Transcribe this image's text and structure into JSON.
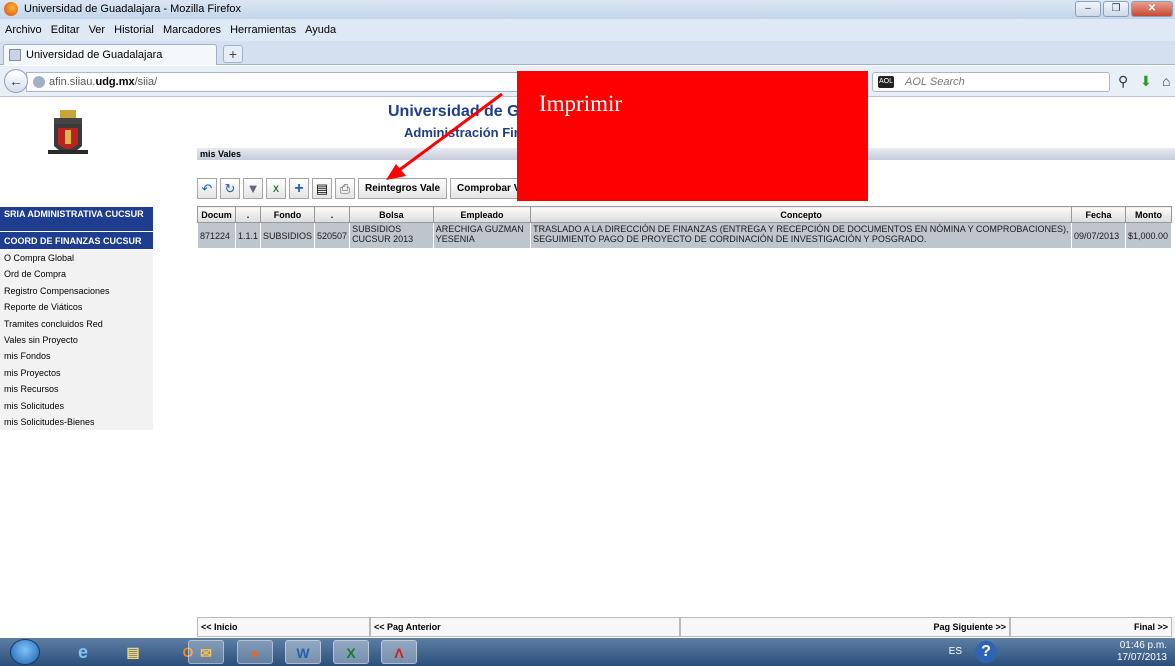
{
  "window": {
    "title": "Universidad de Guadalajara - Mozilla Firefox"
  },
  "menu": [
    "Archivo",
    "Editar",
    "Ver",
    "Historial",
    "Marcadores",
    "Herramientas",
    "Ayuda"
  ],
  "tab": {
    "label": "Universidad de Guadalajara",
    "new_tab": "+"
  },
  "nav": {
    "url_prefix": "afin.siiau.",
    "url_host": "udg.mx",
    "url_suffix": "/siia/",
    "search_placeholder": "AOL Search",
    "search_engine": "AOL"
  },
  "header": {
    "title": "Universidad de Guadalajara",
    "subtitle": "Administración Financiera",
    "section": "mis Vales"
  },
  "toolbar": {
    "reintegros_label": "Reintegros Vale",
    "comprobar_label": "Comprobar Vale"
  },
  "sidebar": {
    "heading1": "SRIA ADMINISTRATIVA CUCSUR",
    "heading2": "COORD DE FINANZAS CUCSUR",
    "items": [
      "O Compra Global",
      "Ord de Compra",
      "Registro Compensaciones",
      "Reporte de Viáticos",
      "Tramites concluidos Red",
      "Vales sin Proyecto",
      "mis Fondos",
      "mis Proyectos",
      "mis Recursos",
      "mis Solicitudes",
      "mis Solicitudes-Bienes"
    ]
  },
  "table": {
    "headers": [
      "Docum",
      ".",
      "Fondo",
      ".",
      "Bolsa",
      "Empleado",
      "Concepto",
      "Fecha",
      "Monto"
    ],
    "rows": [
      [
        "871224",
        "1.1.1",
        "SUBSIDIOS",
        "520507",
        "SUBSIDIOS CUCSUR 2013",
        "ARECHIGA GUZMAN YESENIA",
        "TRASLADO A LA DIRECCIÓN DE FINANZAS (ENTREGA Y RECEPCIÓN DE DOCUMENTOS EN NÓMINA Y COMPROBACIONES), SEGUIMIENTO PAGO DE PROYECTO DE CORDINACIÓN DE INVESTIGACIÓN Y POSGRADO.",
        "09/07/2013",
        "$1,000.00"
      ]
    ]
  },
  "pager": {
    "first": "<< Inicio",
    "prev": "<< Pag Anterior",
    "next": "Pag Siguiente >>",
    "last": "Final >>"
  },
  "annotation": {
    "label": "Imprimir",
    "color": "#ff0000"
  },
  "taskbar": {
    "lang": "ES",
    "time": "01:46 p.m.",
    "date": "17/07/2013"
  }
}
